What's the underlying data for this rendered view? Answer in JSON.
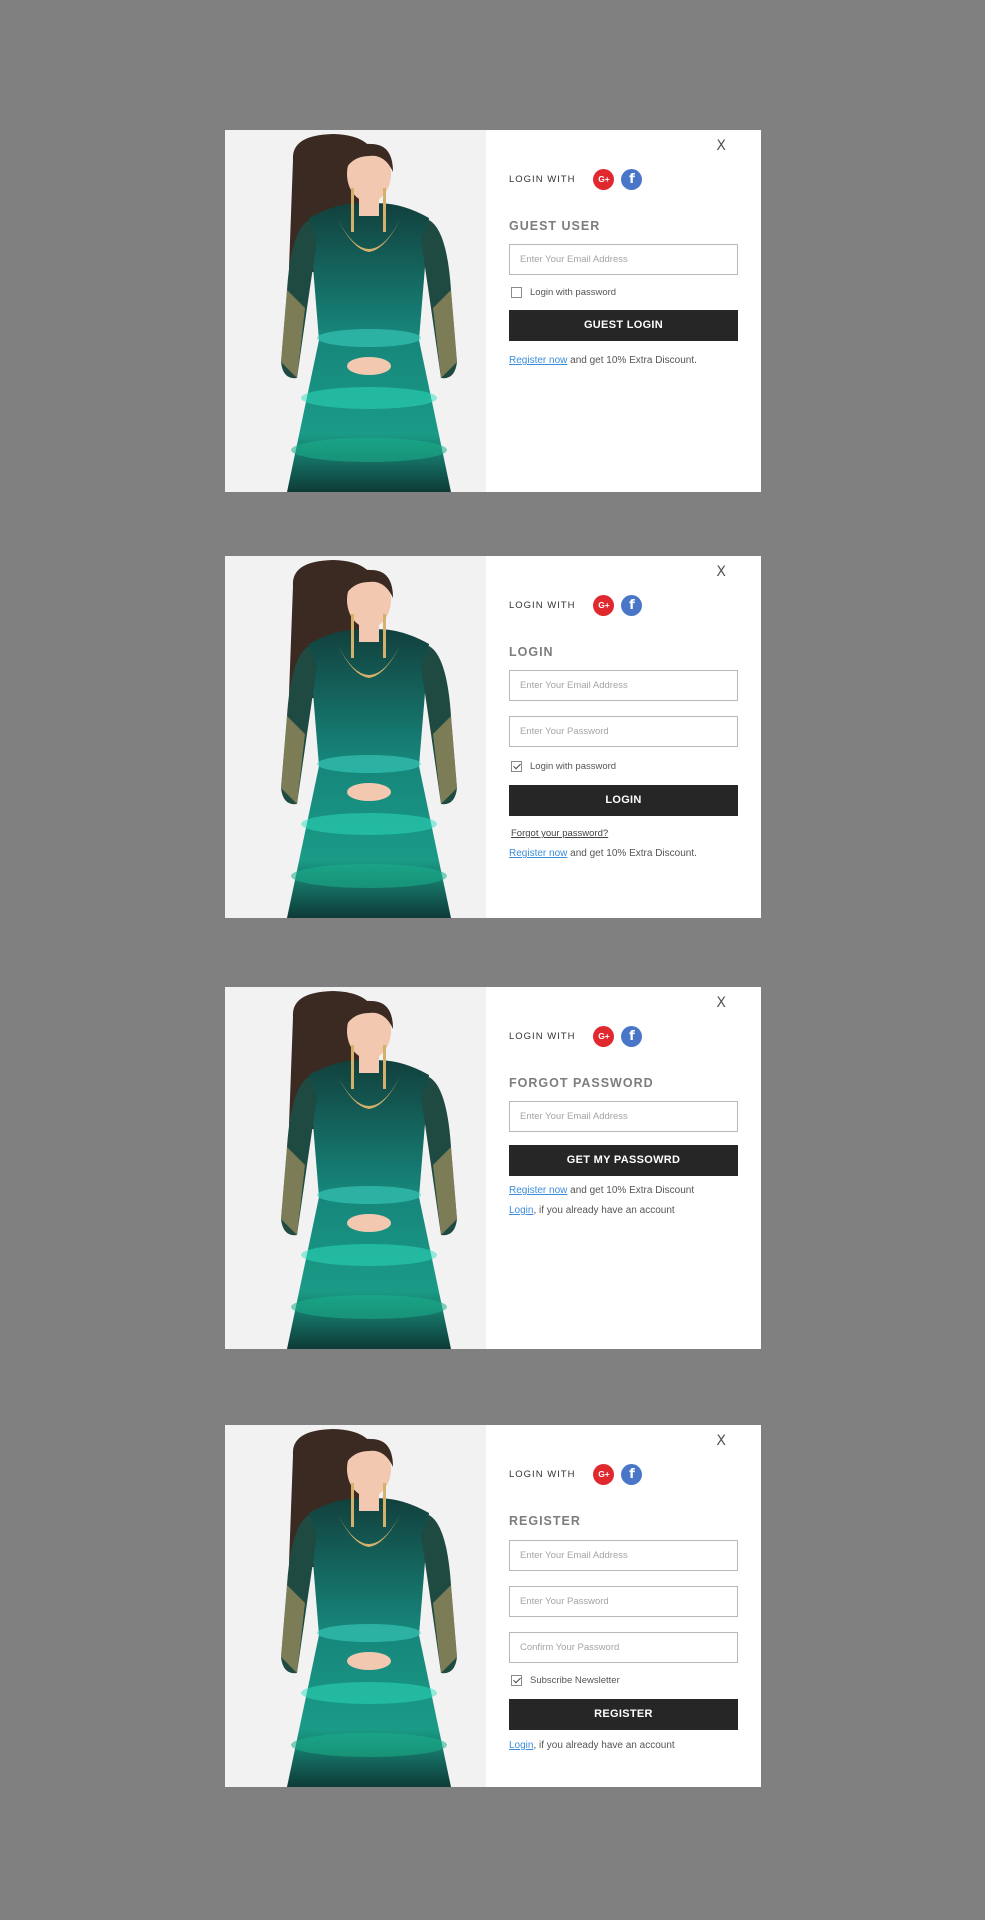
{
  "colors": {
    "background": "#808080",
    "button": "#262626",
    "link": "#3c8ddc",
    "google": "#e0282f",
    "facebook": "#4a76c8"
  },
  "common": {
    "close_label": "X",
    "login_with_label": "LOGIN WITH",
    "google_icon_text": "G+",
    "facebook_icon_text": "f",
    "email_placeholder": "Enter Your Email Address",
    "password_placeholder": "Enter Your Password",
    "confirm_password_placeholder": "Confirm Your Password",
    "register_link": "Register now",
    "login_link": "Login",
    "photo_icon": "model-photo"
  },
  "guest": {
    "heading": "GUEST USER",
    "checkbox_label": "Login with password",
    "checkbox_checked": false,
    "button_label": "GUEST LOGIN",
    "register_suffix": " and get 10% Extra Discount."
  },
  "login": {
    "heading": "LOGIN",
    "checkbox_label": "Login with password",
    "checkbox_checked": true,
    "button_label": "LOGIN",
    "forgot_link": "Forgot your password?",
    "register_suffix": " and get 10% Extra Discount."
  },
  "forgot": {
    "heading": "FORGOT PASSWORD",
    "button_label": "GET MY PASSOWRD",
    "register_suffix": " and get 10% Extra Discount",
    "login_suffix": ", if you already have an account"
  },
  "register": {
    "heading": "REGISTER",
    "checkbox_label": "Subscribe Newsletter",
    "checkbox_checked": true,
    "button_label": "REGISTER",
    "login_suffix": ", if you already have an account"
  }
}
